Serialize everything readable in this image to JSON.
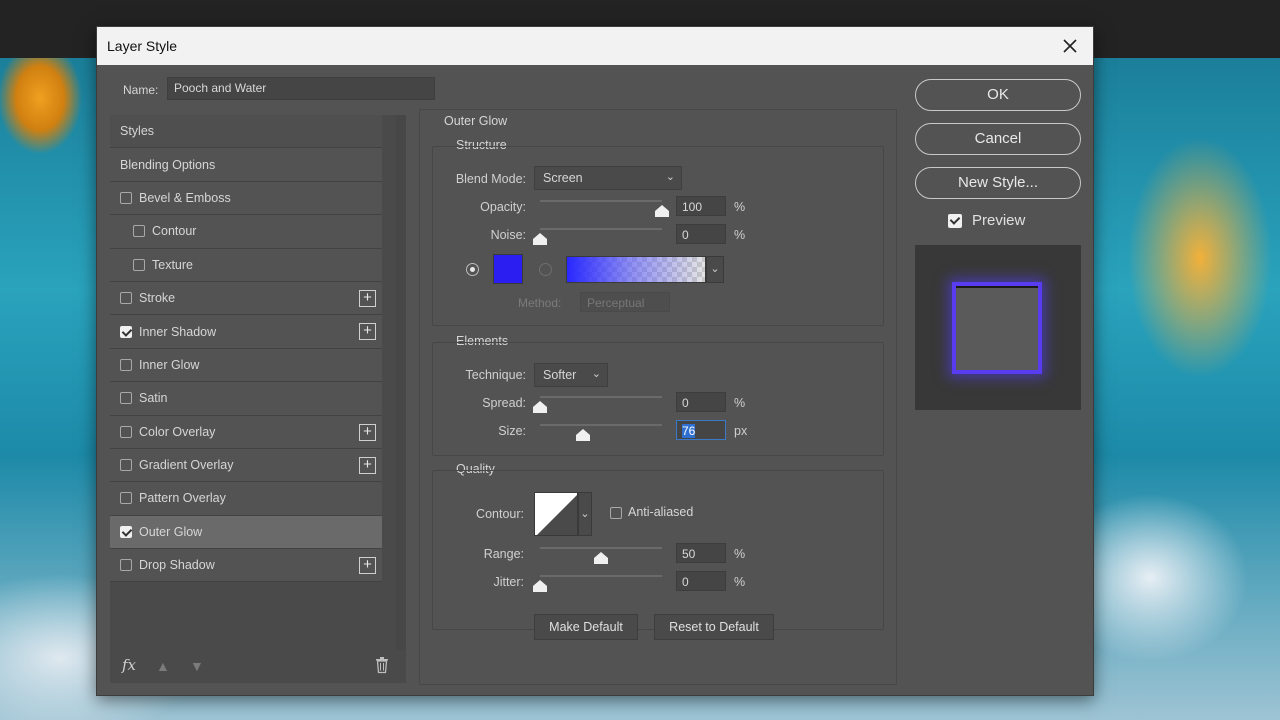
{
  "dialog": {
    "title": "Layer Style",
    "name_label": "Name:",
    "name_value": "Pooch and Water"
  },
  "styles_panel": {
    "items": [
      {
        "label": "Styles",
        "checkbox": false,
        "checked": false,
        "plus": false
      },
      {
        "label": "Blending Options",
        "checkbox": false,
        "checked": false,
        "plus": false
      },
      {
        "label": "Bevel & Emboss",
        "checkbox": true,
        "checked": false,
        "plus": false
      },
      {
        "label": "Contour",
        "checkbox": true,
        "checked": false,
        "plus": false
      },
      {
        "label": "Texture",
        "checkbox": true,
        "checked": false,
        "plus": false
      },
      {
        "label": "Stroke",
        "checkbox": true,
        "checked": false,
        "plus": true
      },
      {
        "label": "Inner Shadow",
        "checkbox": true,
        "checked": true,
        "plus": true
      },
      {
        "label": "Inner Glow",
        "checkbox": true,
        "checked": false,
        "plus": false
      },
      {
        "label": "Satin",
        "checkbox": true,
        "checked": false,
        "plus": false
      },
      {
        "label": "Color Overlay",
        "checkbox": true,
        "checked": false,
        "plus": true
      },
      {
        "label": "Gradient Overlay",
        "checkbox": true,
        "checked": false,
        "plus": true
      },
      {
        "label": "Pattern Overlay",
        "checkbox": true,
        "checked": false,
        "plus": false
      },
      {
        "label": "Outer Glow",
        "checkbox": true,
        "checked": true,
        "plus": false,
        "selected": true
      },
      {
        "label": "Drop Shadow",
        "checkbox": true,
        "checked": false,
        "plus": true
      }
    ],
    "fx_label": "fx"
  },
  "outer_glow": {
    "title": "Outer Glow",
    "structure": {
      "title": "Structure",
      "blend_mode_label": "Blend Mode:",
      "blend_mode_value": "Screen",
      "opacity_label": "Opacity:",
      "opacity_value": "100",
      "opacity_unit": "%",
      "opacity_fraction": 1.0,
      "noise_label": "Noise:",
      "noise_value": "0",
      "noise_unit": "%",
      "noise_fraction": 0.0,
      "color": "#2a1ef0",
      "method_label": "Method:",
      "method_value": "Perceptual"
    },
    "elements": {
      "title": "Elements",
      "technique_label": "Technique:",
      "technique_value": "Softer",
      "spread_label": "Spread:",
      "spread_value": "0",
      "spread_unit": "%",
      "spread_fraction": 0.0,
      "size_label": "Size:",
      "size_value": "76",
      "size_unit": "px",
      "size_fraction": 0.35
    },
    "quality": {
      "title": "Quality",
      "contour_label": "Contour:",
      "anti_aliased_label": "Anti-aliased",
      "range_label": "Range:",
      "range_value": "50",
      "range_unit": "%",
      "range_fraction": 0.5,
      "jitter_label": "Jitter:",
      "jitter_value": "0",
      "jitter_unit": "%",
      "jitter_fraction": 0.0
    },
    "make_default": "Make Default",
    "reset_default": "Reset to Default"
  },
  "buttons": {
    "ok": "OK",
    "cancel": "Cancel",
    "new_style": "New Style...",
    "preview_label": "Preview"
  }
}
